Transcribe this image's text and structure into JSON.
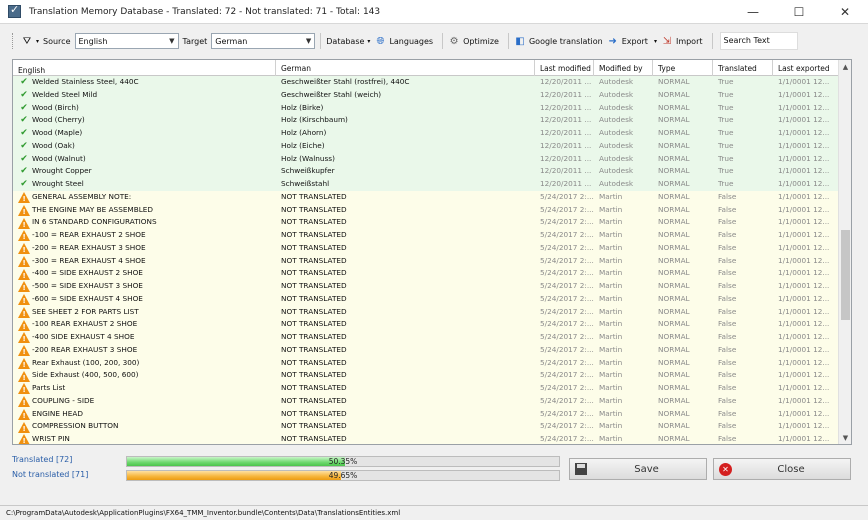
{
  "window": {
    "title": "Translation Memory Database - Translated: 72 - Not translated: 71 - Total: 143",
    "minimize": "—",
    "maximize": "☐",
    "close": "✕"
  },
  "toolbar": {
    "source_label": "Source",
    "source_value": "English",
    "target_label": "Target",
    "target_value": "German",
    "database_label": "Database",
    "languages_label": "Languages",
    "optimize_label": "Optimize",
    "google_label": "Google translation",
    "export_label": "Export",
    "import_label": "Import",
    "search_placeholder": "Search Text"
  },
  "columns": {
    "english": "English",
    "german": "German",
    "last_modified": "Last modified",
    "modified_by": "Modified by",
    "type": "Type",
    "translated": "Translated",
    "last_exported": "Last exported"
  },
  "rows": [
    {
      "status": "ok",
      "english": "Welded Stainless Steel, 440C",
      "german": "Geschweißter Stahl (rostfrei), 440C",
      "modified": "12/20/2011 ...",
      "by": "Autodesk",
      "type": "NORMAL",
      "translated": "True",
      "exported": "1/1/0001 12..."
    },
    {
      "status": "ok",
      "english": "Welded Steel Mild",
      "german": "Geschweißter Stahl (weich)",
      "modified": "12/20/2011 ...",
      "by": "Autodesk",
      "type": "NORMAL",
      "translated": "True",
      "exported": "1/1/0001 12..."
    },
    {
      "status": "ok",
      "english": "Wood (Birch)",
      "german": "Holz (Birke)",
      "modified": "12/20/2011 ...",
      "by": "Autodesk",
      "type": "NORMAL",
      "translated": "True",
      "exported": "1/1/0001 12..."
    },
    {
      "status": "ok",
      "english": "Wood (Cherry)",
      "german": "Holz (Kirschbaum)",
      "modified": "12/20/2011 ...",
      "by": "Autodesk",
      "type": "NORMAL",
      "translated": "True",
      "exported": "1/1/0001 12..."
    },
    {
      "status": "ok",
      "english": "Wood (Maple)",
      "german": "Holz (Ahorn)",
      "modified": "12/20/2011 ...",
      "by": "Autodesk",
      "type": "NORMAL",
      "translated": "True",
      "exported": "1/1/0001 12..."
    },
    {
      "status": "ok",
      "english": "Wood (Oak)",
      "german": "Holz (Eiche)",
      "modified": "12/20/2011 ...",
      "by": "Autodesk",
      "type": "NORMAL",
      "translated": "True",
      "exported": "1/1/0001 12..."
    },
    {
      "status": "ok",
      "english": "Wood (Walnut)",
      "german": "Holz (Walnuss)",
      "modified": "12/20/2011 ...",
      "by": "Autodesk",
      "type": "NORMAL",
      "translated": "True",
      "exported": "1/1/0001 12..."
    },
    {
      "status": "ok",
      "english": "Wrought Copper",
      "german": "Schweißkupfer",
      "modified": "12/20/2011 ...",
      "by": "Autodesk",
      "type": "NORMAL",
      "translated": "True",
      "exported": "1/1/0001 12..."
    },
    {
      "status": "ok",
      "english": "Wrought Steel",
      "german": "Schweißstahl",
      "modified": "12/20/2011 ...",
      "by": "Autodesk",
      "type": "NORMAL",
      "translated": "True",
      "exported": "1/1/0001 12..."
    },
    {
      "status": "warn",
      "english": "GENERAL ASSEMBLY NOTE:",
      "german": "NOT TRANSLATED",
      "modified": "5/24/2017 2:...",
      "by": "Martin",
      "type": "NORMAL",
      "translated": "False",
      "exported": "1/1/0001 12..."
    },
    {
      "status": "warn",
      "english": "THE ENGINE MAY BE ASSEMBLED",
      "german": "NOT TRANSLATED",
      "modified": "5/24/2017 2:...",
      "by": "Martin",
      "type": "NORMAL",
      "translated": "False",
      "exported": "1/1/0001 12..."
    },
    {
      "status": "warn",
      "english": "IN 6  STANDARD CONFIGURATIONS",
      "german": "NOT TRANSLATED",
      "modified": "5/24/2017 2:...",
      "by": "Martin",
      "type": "NORMAL",
      "translated": "False",
      "exported": "1/1/0001 12..."
    },
    {
      "status": "warn",
      "english": "-100 = REAR EXHAUST 2 SHOE",
      "german": "NOT TRANSLATED",
      "modified": "5/24/2017 2:...",
      "by": "Martin",
      "type": "NORMAL",
      "translated": "False",
      "exported": "1/1/0001 12..."
    },
    {
      "status": "warn",
      "english": "-200 = REAR EXHAUST 3 SHOE",
      "german": "NOT TRANSLATED",
      "modified": "5/24/2017 2:...",
      "by": "Martin",
      "type": "NORMAL",
      "translated": "False",
      "exported": "1/1/0001 12..."
    },
    {
      "status": "warn",
      "english": "-300 = REAR EXHAUST 4 SHOE",
      "german": "NOT TRANSLATED",
      "modified": "5/24/2017 2:...",
      "by": "Martin",
      "type": "NORMAL",
      "translated": "False",
      "exported": "1/1/0001 12..."
    },
    {
      "status": "warn",
      "english": "-400 = SIDE EXHAUST 2 SHOE",
      "german": "NOT TRANSLATED",
      "modified": "5/24/2017 2:...",
      "by": "Martin",
      "type": "NORMAL",
      "translated": "False",
      "exported": "1/1/0001 12..."
    },
    {
      "status": "warn",
      "english": "-500 = SIDE EXHAUST 3 SHOE",
      "german": "NOT TRANSLATED",
      "modified": "5/24/2017 2:...",
      "by": "Martin",
      "type": "NORMAL",
      "translated": "False",
      "exported": "1/1/0001 12..."
    },
    {
      "status": "warn",
      "english": "-600 = SIDE EXHAUST 4 SHOE",
      "german": "NOT TRANSLATED",
      "modified": "5/24/2017 2:...",
      "by": "Martin",
      "type": "NORMAL",
      "translated": "False",
      "exported": "1/1/0001 12..."
    },
    {
      "status": "warn",
      "english": "SEE SHEET 2 FOR PARTS LIST",
      "german": "NOT TRANSLATED",
      "modified": "5/24/2017 2:...",
      "by": "Martin",
      "type": "NORMAL",
      "translated": "False",
      "exported": "1/1/0001 12..."
    },
    {
      "status": "warn",
      "english": "-100 REAR EXHAUST 2 SHOE",
      "german": "NOT TRANSLATED",
      "modified": "5/24/2017 2:...",
      "by": "Martin",
      "type": "NORMAL",
      "translated": "False",
      "exported": "1/1/0001 12..."
    },
    {
      "status": "warn",
      "english": "-400 SIDE EXHAUST 4 SHOE",
      "german": "NOT TRANSLATED",
      "modified": "5/24/2017 2:...",
      "by": "Martin",
      "type": "NORMAL",
      "translated": "False",
      "exported": "1/1/0001 12..."
    },
    {
      "status": "warn",
      "english": "-200 REAR EXHAUST 3 SHOE",
      "german": "NOT TRANSLATED",
      "modified": "5/24/2017 2:...",
      "by": "Martin",
      "type": "NORMAL",
      "translated": "False",
      "exported": "1/1/0001 12..."
    },
    {
      "status": "warn",
      "english": "Rear Exhaust (100, 200, 300)",
      "german": "NOT TRANSLATED",
      "modified": "5/24/2017 2:...",
      "by": "Martin",
      "type": "NORMAL",
      "translated": "False",
      "exported": "1/1/0001 12..."
    },
    {
      "status": "warn",
      "english": "Side Exhaust (400, 500, 600)",
      "german": "NOT TRANSLATED",
      "modified": "5/24/2017 2:...",
      "by": "Martin",
      "type": "NORMAL",
      "translated": "False",
      "exported": "1/1/0001 12..."
    },
    {
      "status": "warn",
      "english": "Parts List",
      "german": "NOT TRANSLATED",
      "modified": "5/24/2017 2:...",
      "by": "Martin",
      "type": "NORMAL",
      "translated": "False",
      "exported": "1/1/0001 12..."
    },
    {
      "status": "warn",
      "english": "COUPLING - SIDE",
      "german": "NOT TRANSLATED",
      "modified": "5/24/2017 2:...",
      "by": "Martin",
      "type": "NORMAL",
      "translated": "False",
      "exported": "1/1/0001 12..."
    },
    {
      "status": "warn",
      "english": "ENGINE HEAD",
      "german": "NOT TRANSLATED",
      "modified": "5/24/2017 2:...",
      "by": "Martin",
      "type": "NORMAL",
      "translated": "False",
      "exported": "1/1/0001 12..."
    },
    {
      "status": "warn",
      "english": "COMPRESSION BUTTON",
      "german": "NOT TRANSLATED",
      "modified": "5/24/2017 2:...",
      "by": "Martin",
      "type": "NORMAL",
      "translated": "False",
      "exported": "1/1/0001 12..."
    },
    {
      "status": "warn",
      "english": "WRIST PIN",
      "german": "NOT TRANSLATED",
      "modified": "5/24/2017 2:...",
      "by": "Martin",
      "type": "NORMAL",
      "translated": "False",
      "exported": "1/1/0001 12..."
    }
  ],
  "stats": {
    "translated_label": "Translated [72]",
    "translated_percent_text": "50.35%",
    "translated_fraction": 0.5035,
    "not_translated_label": "Not translated [71]",
    "not_translated_percent_text": "49.65%",
    "not_translated_fraction": 0.4965
  },
  "buttons": {
    "save": "Save",
    "close": "Close"
  },
  "statusbar": {
    "path": "C:\\ProgramData\\Autodesk\\ApplicationPlugins\\FX64_TMM_Inventor.bundle\\Contents\\Data\\TranslationsEntities.xml"
  },
  "icons": {
    "ok": "check-icon",
    "warn": "warning-icon"
  },
  "colors": {
    "translated_row": "#eaf8ea",
    "untranslated_row": "#fdfde9",
    "check": "#2f9a2f",
    "warning": "#f0900f",
    "progress_green": "#4cc44c",
    "progress_orange": "#ec9c12"
  }
}
